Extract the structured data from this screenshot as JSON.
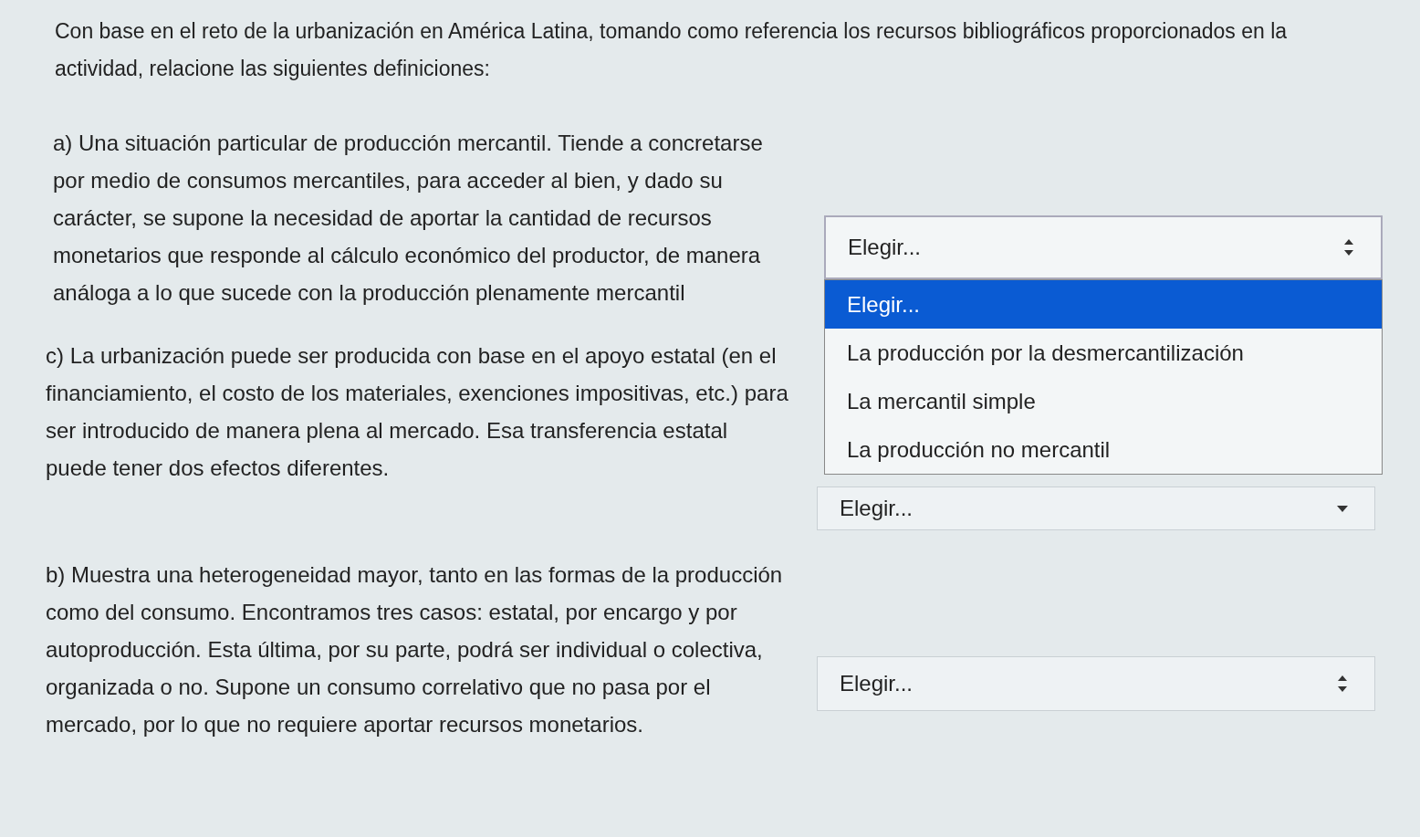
{
  "intro": "Con base en el reto de la urbanización en América Latina, tomando como referencia los recursos bibliográficos proporcionados en la actividad, relacione las siguientes definiciones:",
  "questions": [
    {
      "text": "a) Una situación particular de producción mercantil. Tiende a concretarse por medio de consumos mercantiles, para acceder al bien, y dado su carácter, se supone la necesidad de aportar la cantidad de recursos monetarios que responde al cálculo económico del productor, de manera análoga a lo que sucede con la producción plenamente mercantil",
      "select": {
        "value": "Elegir...",
        "open": true,
        "options": [
          {
            "label": "Elegir...",
            "selected": true
          },
          {
            "label": "La producción por la desmercantilización",
            "selected": false
          },
          {
            "label": "La mercantil simple",
            "selected": false
          },
          {
            "label": "La producción no mercantil",
            "selected": false
          }
        ]
      }
    },
    {
      "text": "c) La urbanización puede ser producida con base en el apoyo estatal (en el financiamiento, el costo de los materiales, exenciones impositivas, etc.) para ser introducido de manera plena al mercado. Esa transferencia estatal puede tener dos efectos diferentes.",
      "select": {
        "value": "Elegir...",
        "open": false
      }
    },
    {
      "text": "b) Muestra una heterogeneidad mayor, tanto en las formas de la producción como del consumo. Encontramos tres casos: estatal, por encargo y por autoproducción. Esta última, por su parte, podrá ser individual o colectiva, organizada o no. Supone un consumo correlativo que no pasa por el mercado, por lo que no requiere aportar recursos monetarios.",
      "select": {
        "value": "Elegir...",
        "open": false
      }
    }
  ]
}
